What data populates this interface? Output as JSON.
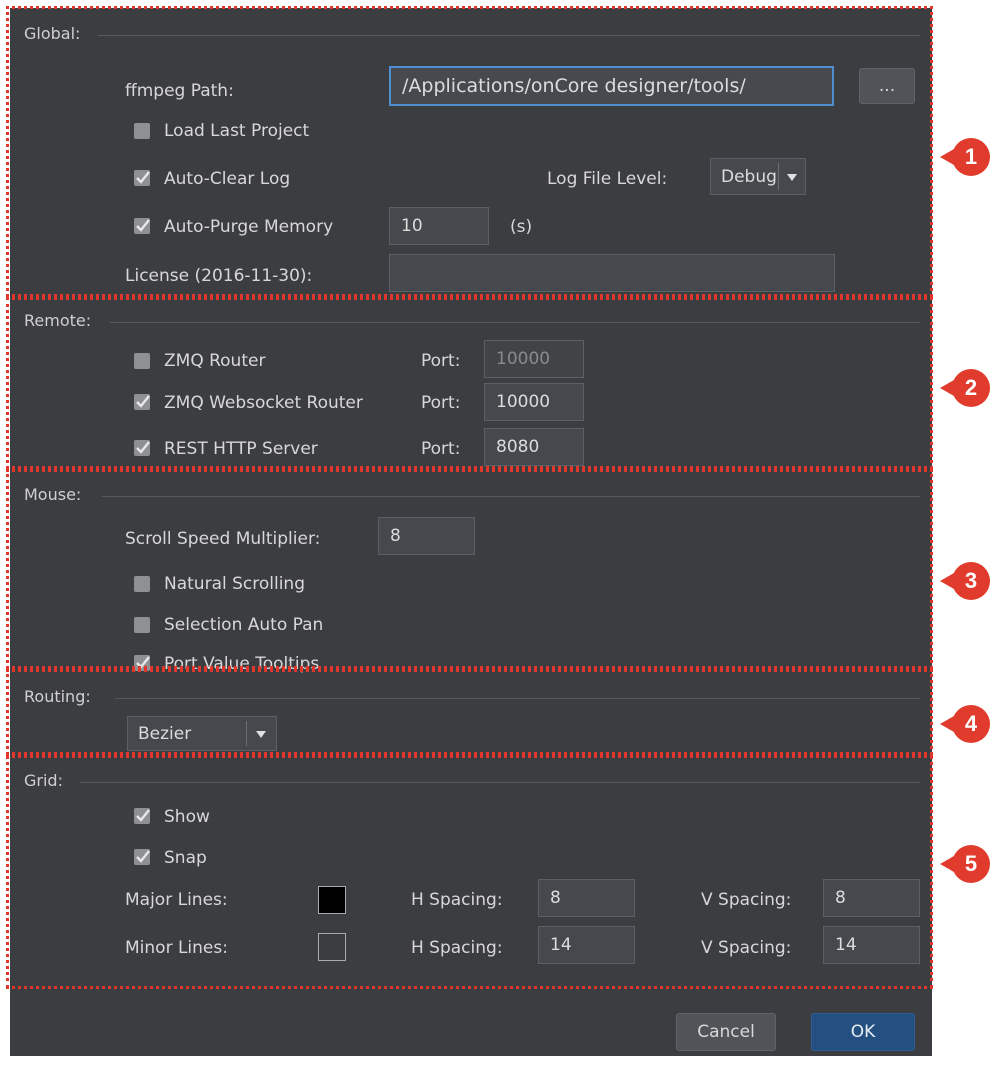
{
  "global": {
    "title": "Global:",
    "ffmpeg_label": "ffmpeg Path:",
    "ffmpeg_value": "/Applications/onCore designer/tools/",
    "browse_label": "...",
    "load_last_project": {
      "label": "Load Last Project",
      "checked": false
    },
    "auto_clear_log": {
      "label": "Auto-Clear Log",
      "checked": true
    },
    "log_level_label": "Log File Level:",
    "log_level_value": "Debug",
    "auto_purge_memory": {
      "label": "Auto-Purge Memory",
      "checked": true,
      "value": "10",
      "unit": "(s)"
    },
    "license_label": "License (2016-11-30):",
    "license_value": ""
  },
  "remote": {
    "title": "Remote:",
    "port_label": "Port:",
    "zmq_router": {
      "label": "ZMQ Router",
      "checked": false,
      "port": "10000"
    },
    "zmq_websocket_router": {
      "label": "ZMQ Websocket Router",
      "checked": true,
      "port": "10000"
    },
    "rest_http_server": {
      "label": "REST HTTP Server",
      "checked": true,
      "port": "8080"
    }
  },
  "mouse": {
    "title": "Mouse:",
    "scroll_speed_label": "Scroll Speed Multiplier:",
    "scroll_speed_value": "8",
    "natural_scrolling": {
      "label": "Natural Scrolling",
      "checked": false
    },
    "selection_auto_pan": {
      "label": "Selection Auto Pan",
      "checked": false
    },
    "port_value_tooltips": {
      "label": "Port Value Tooltips",
      "checked": true
    }
  },
  "routing": {
    "title": "Routing:",
    "value": "Bezier"
  },
  "grid": {
    "title": "Grid:",
    "show": {
      "label": "Show",
      "checked": true
    },
    "snap": {
      "label": "Snap",
      "checked": true
    },
    "h_spacing_label": "H Spacing:",
    "v_spacing_label": "V Spacing:",
    "major": {
      "label": "Major Lines:",
      "color": "#000000",
      "h_spacing": "8",
      "v_spacing": "8"
    },
    "minor": {
      "label": "Minor Lines:",
      "color": "#3a3c3f",
      "h_spacing": "14",
      "v_spacing": "14"
    }
  },
  "buttons": {
    "cancel": "Cancel",
    "ok": "OK"
  },
  "callouts": [
    "1",
    "2",
    "3",
    "4",
    "5"
  ],
  "colors": {
    "dialog_bg": "#3b3d40",
    "annotation_red": "#e03b2c",
    "focus_blue": "#4f8ed1",
    "primary_button": "#245081"
  }
}
